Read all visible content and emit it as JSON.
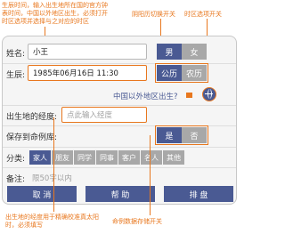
{
  "annotations": {
    "top_left": "生辰时间，输入出生地所在国的官方钟表时间，中国以外地区出生，必须打开时区选项并选择与之对应的时区",
    "yinyang": "阴阳历切换开关",
    "timezone": "时区选项开关",
    "bottom_left": "出生地的经度用于精确校准真太阳时，必须填写",
    "bottom_mid": "命例数据存储开关"
  },
  "form": {
    "name": {
      "label": "姓名:",
      "value": "小王"
    },
    "gender": {
      "male": "男",
      "female": "女",
      "selected": "男"
    },
    "birth": {
      "label": "生辰:",
      "value": "1985年06月16日 11:30"
    },
    "calendar": {
      "solar": "公历",
      "lunar": "农历",
      "selected": "公历"
    },
    "overseas": {
      "text": "中国以外地区出生?"
    },
    "longitude": {
      "label": "出生地的经度:",
      "placeholder": "点此输入经度"
    },
    "save": {
      "label": "保存到命例库:",
      "yes": "是",
      "no": "否",
      "selected": "是"
    },
    "category": {
      "label": "分类:",
      "options": [
        "家人",
        "朋友",
        "同学",
        "同事",
        "客户",
        "名人",
        "其他"
      ],
      "selected": "家人"
    },
    "note": {
      "label": "备注:",
      "placeholder": "限50字以内"
    }
  },
  "actions": {
    "cancel": "取 消",
    "help": "帮 助",
    "chart": "排 盘"
  },
  "colors": {
    "accent": "#e8771e",
    "primary": "#4a5a93",
    "inactive": "#a8a8a8"
  }
}
